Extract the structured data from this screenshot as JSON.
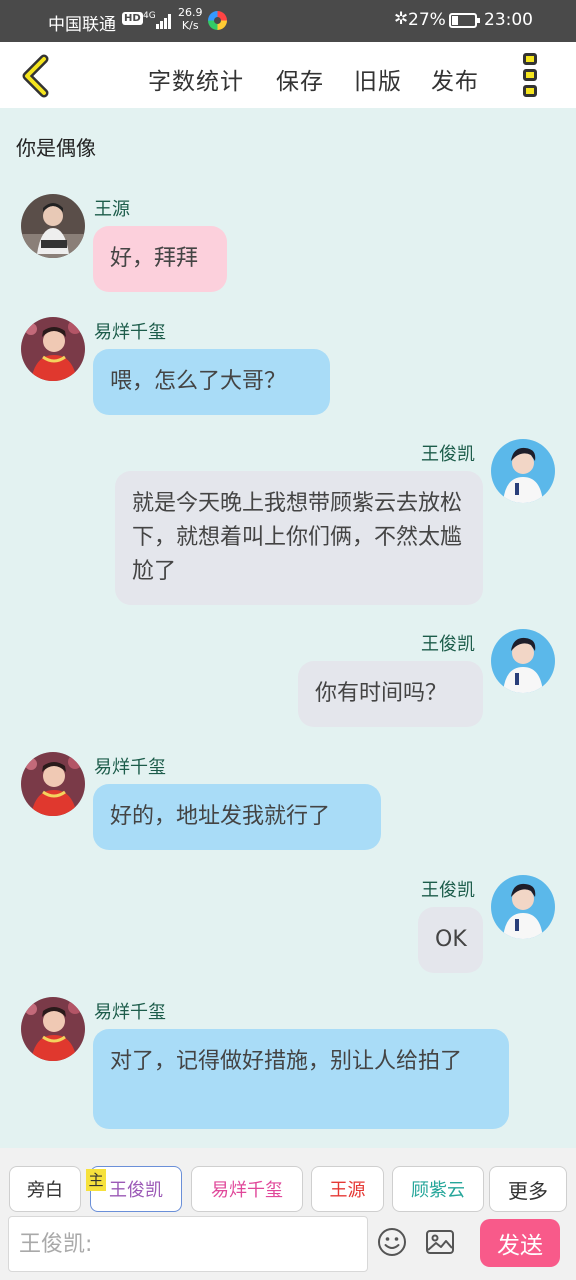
{
  "status_bar": {
    "carrier": "中国联通",
    "hd": "HD",
    "network": "4G",
    "speed_value": "26.9",
    "speed_unit": "K/s",
    "battery": "27%",
    "time": "23:00"
  },
  "toolbar": {
    "word_count": "字数统计",
    "save": "保存",
    "old_version": "旧版",
    "publish": "发布"
  },
  "story_title": "你是偶像",
  "messages": [
    {
      "speaker": "王源",
      "text": "好，拜拜"
    },
    {
      "speaker": "易烊千玺",
      "text": "喂，怎么了大哥？"
    },
    {
      "speaker": "王俊凯",
      "text": "就是今天晚上我想带顾紫云去放松下，就想着叫上你们俩，不然太尴尬了"
    },
    {
      "speaker": "王俊凯",
      "text": "你有时间吗？"
    },
    {
      "speaker": "易烊千玺",
      "text": "好的，地址发我就行了"
    },
    {
      "speaker": "王俊凯",
      "text": "OK"
    },
    {
      "speaker": "易烊千玺",
      "text": "对了，记得做好措施，别让人给拍了"
    }
  ],
  "role_bar": {
    "narration": "旁白",
    "main_tag": "主",
    "roles": [
      "王俊凯",
      "易烊千玺",
      "王源",
      "顾紫云"
    ],
    "more": "更多"
  },
  "composer": {
    "placeholder": "王俊凯:",
    "send": "发送"
  },
  "colors": {
    "background": "#e3f2f1",
    "pink_bubble": "#fcd0dc",
    "blue_bubble": "#a9dcf7",
    "gray_bubble": "#e4e6ec",
    "send_button": "#f85a8a",
    "role_wang_junkai": "#9b59b6",
    "role_yi_yangqianxi": "#e0489a",
    "role_wang_yuan": "#e53935",
    "role_gu_ziyun": "#26a69a"
  },
  "icons": [
    "back-chevron-icon",
    "more-menu-icon",
    "emoji-icon",
    "image-icon"
  ]
}
